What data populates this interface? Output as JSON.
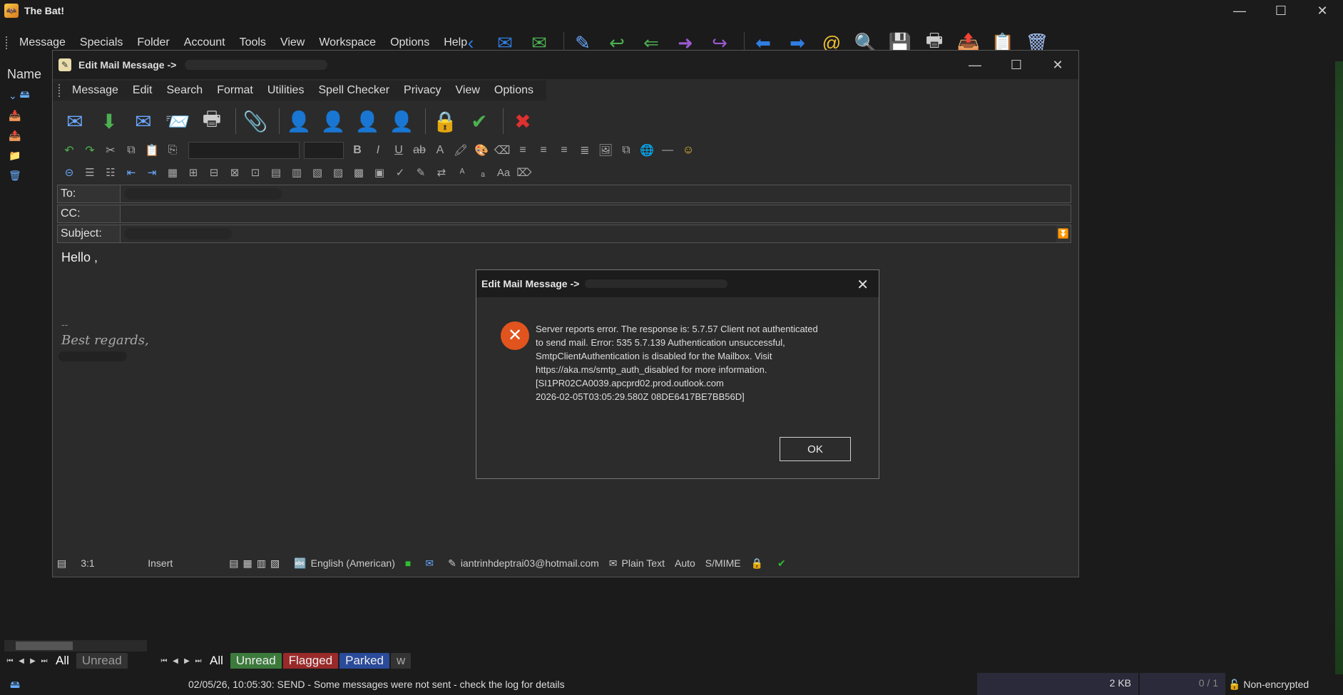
{
  "main": {
    "title": "The Bat!",
    "menu": [
      "Message",
      "Specials",
      "Folder",
      "Account",
      "Tools",
      "View",
      "Workspace",
      "Options",
      "Help"
    ],
    "name_header": "Name",
    "tabs_left": [
      "All",
      "Unread"
    ],
    "tabs_right": [
      "All",
      "Unread",
      "Flagged",
      "Parked",
      "w"
    ],
    "status": {
      "log": "02/05/26, 10:05:30: SEND  - Some messages were not sent - check the log for details",
      "size": "2 KB",
      "count": "0 / 1",
      "encryption": "Non-encrypted"
    }
  },
  "editor": {
    "title": "Edit Mail Message ->",
    "menu": [
      "Message",
      "Edit",
      "Search",
      "Format",
      "Utilities",
      "Spell Checker",
      "Privacy",
      "View",
      "Options"
    ],
    "fields": {
      "to_label": "To:",
      "cc_label": "CC:",
      "subject_label": "Subject:"
    },
    "body": {
      "greeting": "Hello ,",
      "sig_dash": "--",
      "regards": "Best regards,"
    },
    "status": {
      "position": "3:1",
      "mode": "Insert",
      "language": "English (American)",
      "account": "iantrinhdeptrai03@hotmail.com",
      "format": "Plain Text",
      "auto": "Auto",
      "smime": "S/MIME"
    }
  },
  "dialog": {
    "title": "Edit Mail Message ->",
    "message": "Server reports error. The response is: 5.7.57 Client not authenticated\nto send mail. Error: 535 5.7.139 Authentication unsuccessful,\nSmtpClientAuthentication is disabled for the Mailbox. Visit\nhttps://aka.ms/smtp_auth_disabled for more information.\n[SI1PR02CA0039.apcprd02.prod.outlook.com\n2026-02-05T03:05:29.580Z 08DE6417BE7BB56D]",
    "ok_label": "OK"
  },
  "colors": {
    "error": "#e2541d",
    "background": "#1b1b1b",
    "accent_blue": "#2f7de1"
  }
}
